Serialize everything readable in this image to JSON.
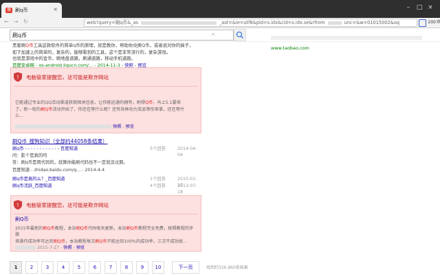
{
  "browser": {
    "tab_icon": "搜",
    "tab_title": "刷q币",
    "tab_close": "×",
    "url_a": "web?query=刷q币&_as",
    "url_b": "_ast=&ie=utf8&pid=s.idx&cid=s.idx.se&rfrom",
    "url_c": "unc=&w=01015002&oq",
    "ext_count": "200",
    "win_min": "–",
    "win_max": "□",
    "win_close": "×",
    "back": "←",
    "forward": "→",
    "reload": "↻",
    "menu": "≡"
  },
  "search": {
    "query": "刷q币",
    "clear": "×"
  },
  "ad": {
    "url": "www.taobao.com"
  },
  "result1": {
    "line1a": "黑客刷",
    "line1b": "Q币",
    "line1c": "工具这款软件的简单q币的原理，就是教你，帮助你兑换Q币，或者说对你的搞子，",
    "line2": "如下加速上的简单的，复杂的，能够看到的工具，这个是非常流行的，复杂游戏。",
    "line3": "也就是游戏中的金币，刷地盘道路，刷通道路，移动手机道路。",
    "src": "百度安卓网 - os-android.liqucn.com/... - 2014-11-3 -",
    "snapshot": "快照",
    "preview": "预览"
  },
  "warn_title": "电脑管家提醒您，这可能是欺诈网站",
  "warn1": {
    "l1a": "它能通过专业的QQ活动渠道获取相关信息，让你能迅速的拥有，刷得",
    "l1b": "Q币",
    "l1c": "，马上5.1要来",
    "l2a": "了，新一轮的",
    "l2b": "刷Q币",
    "l2c": "活动开始了，你还在等什么呢？还有各种功力奖品等你来拿，还在等什",
    "l3": "么...",
    "snapshot": "快照",
    "preview": "预览"
  },
  "zhidao": {
    "title": "刷Q币_搜狗知识（全部约44058条结果）",
    "rows": [
      {
        "q": "刷q币",
        "stars": "- - - - - - - - - - - -",
        "tag": "百度知道",
        "count": "5个回答",
        "date": "2014-04-04"
      },
      {
        "q": "问：影个是真的吗",
        "count": "",
        "date": ""
      },
      {
        "q": "答：刷q币是用代码的，就算你能刷代码也不一定就没过期。",
        "count": "",
        "date": ""
      },
      {
        "q": "百度知道 - zhidao.baidu.com/q... - 2014-4-4",
        "count": "",
        "date": ""
      },
      {
        "q": "刷q币是真的么？",
        "tag": "_百度知道",
        "count": "1个回答",
        "date": "2015-01-10"
      },
      {
        "q": "刷q币活跃",
        "tag": "_百度知道",
        "count": "4个回答",
        "date": "2013-07-18"
      }
    ]
  },
  "warn2": {
    "link": "刷Q币",
    "l1a": "2015年最新的",
    "l1b": "刷Q币",
    "l1c": "教程，本站",
    "l1d": "刷Q币",
    "l1e": "代码每天更新，本站",
    "l1f": "刷Q币",
    "l1g": "教程完全免费，按照教程的步骤",
    "l2a": "来操作成功率可达到",
    "l2b": "刷Q币",
    "l2c": "，本站教程每次",
    "l2d": "刷Q币",
    "l2e": "不能达到100%的成功率，三次不成功就...",
    "date": "2015-7-27 -",
    "snapshot": "快照",
    "preview": "预览"
  },
  "pager": {
    "pages": [
      "1",
      "2",
      "3",
      "4",
      "5",
      "6",
      "7",
      "8",
      "9",
      "10"
    ],
    "next": "下一页",
    "count_text": "找到约326,860条结果"
  }
}
